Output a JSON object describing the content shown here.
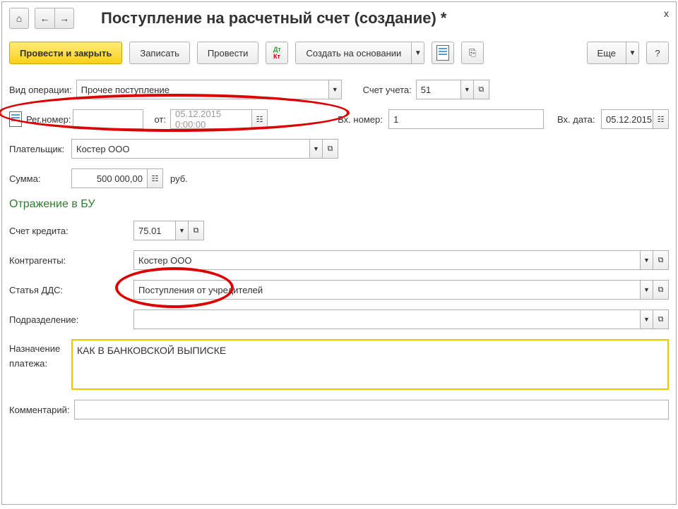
{
  "window": {
    "close": "x",
    "title": "Поступление на расчетный счет (создание) *"
  },
  "nav": {
    "home": "⌂",
    "back": "←",
    "forward": "→"
  },
  "toolbar": {
    "submit_close": "Провести и закрыть",
    "save": "Записать",
    "submit": "Провести",
    "create_based": "Создать на основании",
    "more": "Еще",
    "help": "?"
  },
  "fields": {
    "operation_type": {
      "label": "Вид операции:",
      "value": "Прочее поступление"
    },
    "account": {
      "label": "Счет учета:",
      "value": "51"
    },
    "reg_number": {
      "label": "Рег.номер:",
      "value": ""
    },
    "from": {
      "label": "от:",
      "value": "05.12.2015 0:00:00"
    },
    "in_number": {
      "label": "Вх. номер:",
      "value": "1"
    },
    "in_date": {
      "label": "Вх. дата:",
      "value": "05.12.2015"
    },
    "payer": {
      "label": "Плательщик:",
      "value": "Костер ООО"
    },
    "amount": {
      "label": "Сумма:",
      "value": "500 000,00",
      "currency": "руб."
    },
    "section_bu": "Отражение в БУ",
    "credit_account": {
      "label": "Счет кредита:",
      "value": "75.01"
    },
    "contractor": {
      "label": "Контрагенты:",
      "value": "Костер ООО"
    },
    "dds": {
      "label": "Статья ДДС:",
      "value": "Поступления от учредителей"
    },
    "division": {
      "label": "Подразделение:",
      "value": ""
    },
    "purpose": {
      "label1": "Назначение",
      "label2": "платежа:",
      "value": "КАК В БАНКОВСКОЙ ВЫПИСКЕ"
    },
    "comment": {
      "label": "Комментарий:",
      "value": ""
    }
  }
}
